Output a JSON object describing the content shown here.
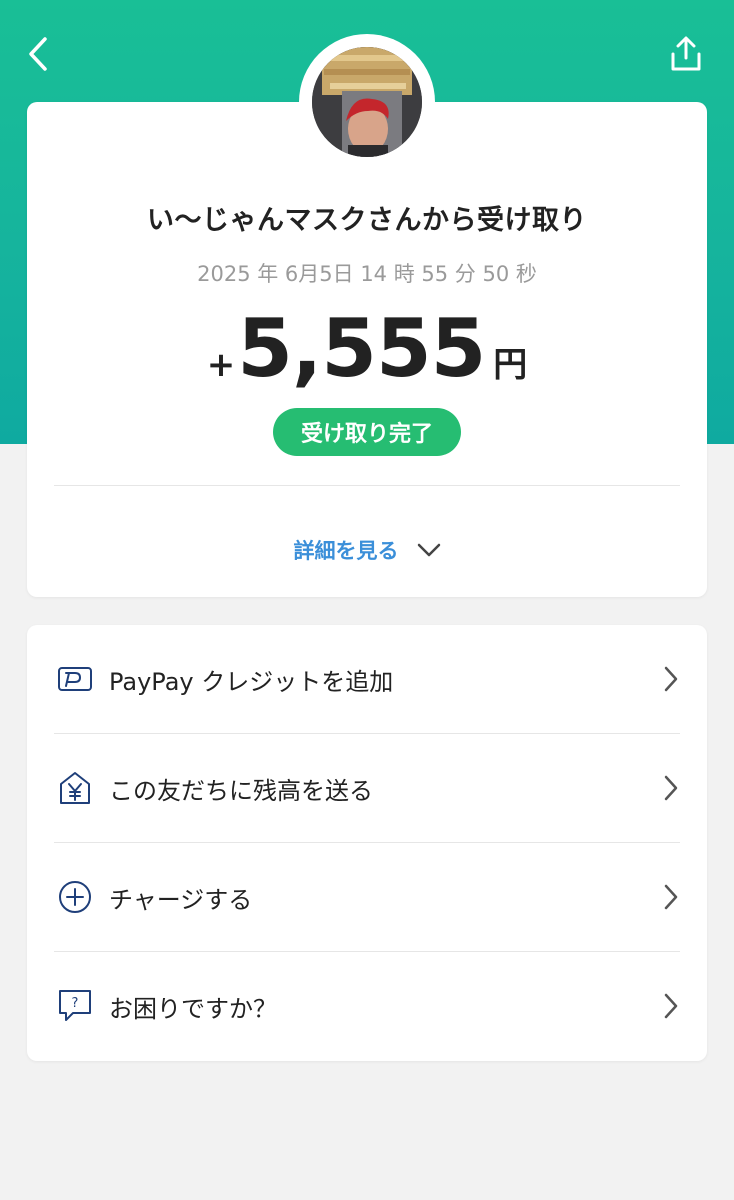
{
  "header": {
    "back_icon": "chevron-left-icon",
    "share_icon": "share-icon",
    "hero_color": "#19bf96"
  },
  "receipt": {
    "title": "い〜じゃんマスクさんから受け取り",
    "timestamp": "2025 年 6月5日 14 時 55 分 50 秒",
    "amount_sign": "+",
    "amount": "5,555",
    "currency": "円",
    "status": "受け取り完了",
    "status_color": "#26bd72",
    "details_label": "詳細を見る",
    "details_icon": "chevron-down-icon",
    "link_color": "#3b8fd9"
  },
  "actions": [
    {
      "label": "PayPay クレジットを追加",
      "icon": "paypay-card-icon"
    },
    {
      "label": "この友だちに残高を送る",
      "icon": "send-yen-icon"
    },
    {
      "label": "チャージする",
      "icon": "plus-circle-icon"
    },
    {
      "label": "お困りですか？",
      "icon": "help-icon"
    }
  ]
}
